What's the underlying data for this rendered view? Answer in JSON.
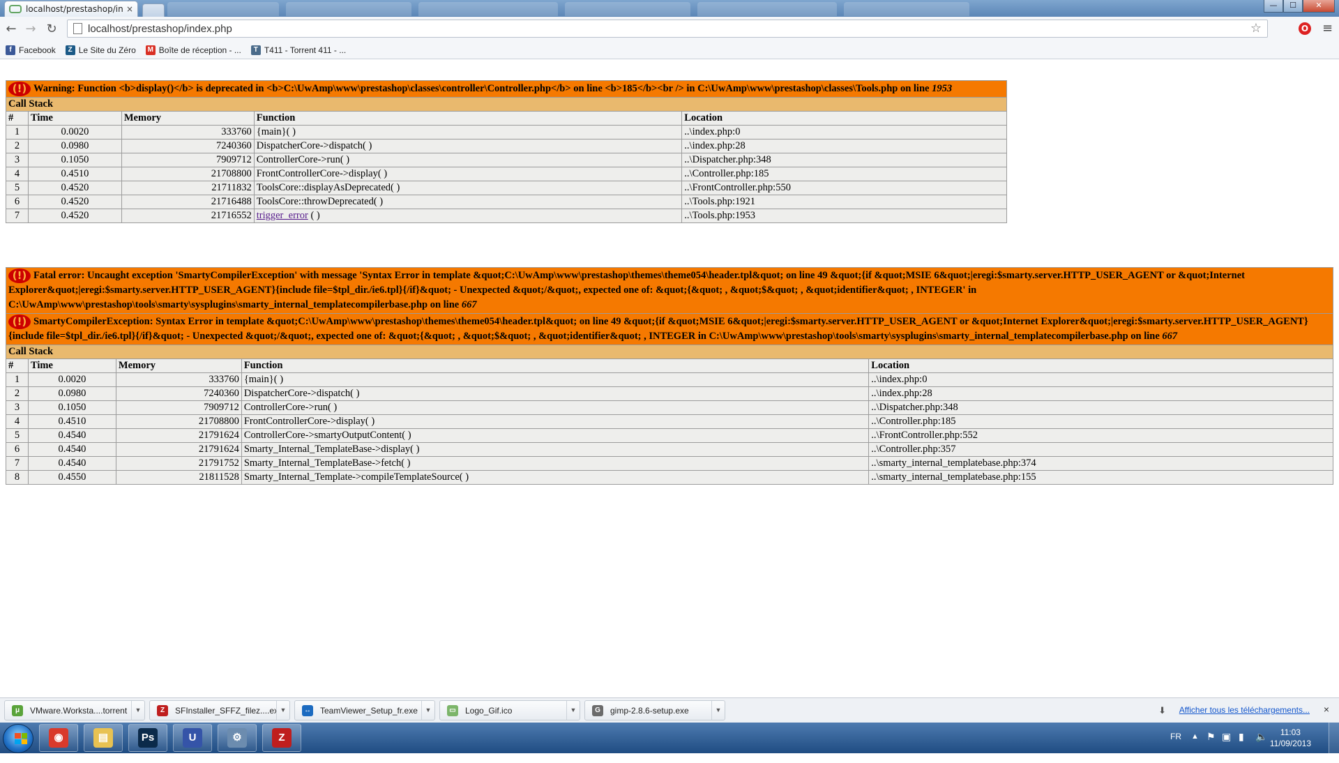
{
  "browser": {
    "tab_title": "localhost/prestashop/index.php",
    "tab_close": "×",
    "address": "localhost/prestashop/index.php",
    "window_controls": {
      "minimize": "—",
      "maximize": "☐",
      "close": "✕"
    },
    "bookmarks": [
      {
        "label": "Facebook",
        "icon": "facebook-icon",
        "color": "#3b5998",
        "glyph": "f"
      },
      {
        "label": "Le Site du Zéro",
        "icon": "siteduzero-icon",
        "color": "#1b5a87",
        "glyph": "Z"
      },
      {
        "label": "Boîte de réception - ...",
        "icon": "gmail-icon",
        "color": "#d93025",
        "glyph": "M"
      },
      {
        "label": "T411 - Torrent 411 - ...",
        "icon": "t411-icon",
        "color": "#4a6b8a",
        "glyph": "T"
      }
    ]
  },
  "warning": {
    "message_prefix": "Warning: Function <b>display()</b> is deprecated in <b>C:\\UwAmp\\www\\prestashop\\classes\\controller\\Controller.php</b> on line <b>185</b><br /> in C:\\UwAmp\\www\\prestashop\\classes\\Tools.php on line ",
    "line": "1953",
    "call_stack_label": "Call Stack",
    "columns": [
      "#",
      "Time",
      "Memory",
      "Function",
      "Location"
    ],
    "rows": [
      {
        "n": "1",
        "time": "0.0020",
        "memory": "333760",
        "func": "{main}( )",
        "loc": "..\\index.php:0"
      },
      {
        "n": "2",
        "time": "0.0980",
        "memory": "7240360",
        "func": "DispatcherCore->dispatch( )",
        "loc": "..\\index.php:28"
      },
      {
        "n": "3",
        "time": "0.1050",
        "memory": "7909712",
        "func": "ControllerCore->run( )",
        "loc": "..\\Dispatcher.php:348"
      },
      {
        "n": "4",
        "time": "0.4510",
        "memory": "21708800",
        "func": "FrontControllerCore->display( )",
        "loc": "..\\Controller.php:185"
      },
      {
        "n": "5",
        "time": "0.4520",
        "memory": "21711832",
        "func": "ToolsCore::displayAsDeprecated( )",
        "loc": "..\\FrontController.php:550"
      },
      {
        "n": "6",
        "time": "0.4520",
        "memory": "21716488",
        "func": "ToolsCore::throwDeprecated( )",
        "loc": "..\\Tools.php:1921"
      },
      {
        "n": "7",
        "time": "0.4520",
        "memory": "21716552",
        "func_link": "trigger_error",
        "func_suffix": " ( )",
        "loc": "..\\Tools.php:1953"
      }
    ]
  },
  "fatal": {
    "message1_prefix": "Fatal error: Uncaught exception 'SmartyCompilerException' with message 'Syntax Error in template &quot;C:\\UwAmp\\www\\prestashop\\themes\\theme054\\header.tpl&quot; on line 49 &quot;{if &quot;MSIE 6&quot;|eregi:$smarty.server.HTTP_USER_AGENT or &quot;Internet Explorer&quot;|eregi:$smarty.server.HTTP_USER_AGENT}{include file=$tpl_dir./ie6.tpl}{/if}&quot; - Unexpected &quot;/&quot;, expected one of: &quot;{&quot; , &quot;$&quot; , &quot;identifier&quot; , INTEGER' in C:\\UwAmp\\www\\prestashop\\tools\\smarty\\sysplugins\\smarty_internal_templatecompilerbase.php on line ",
    "line1": "667",
    "message2_prefix": "SmartyCompilerException: Syntax Error in template &quot;C:\\UwAmp\\www\\prestashop\\themes\\theme054\\header.tpl&quot; on line 49 &quot;{if &quot;MSIE 6&quot;|eregi:$smarty.server.HTTP_USER_AGENT or &quot;Internet Explorer&quot;|eregi:$smarty.server.HTTP_USER_AGENT}{include file=$tpl_dir./ie6.tpl}{/if}&quot; - Unexpected &quot;/&quot;, expected one of: &quot;{&quot; , &quot;$&quot; , &quot;identifier&quot; , INTEGER in C:\\UwAmp\\www\\prestashop\\tools\\smarty\\sysplugins\\smarty_internal_templatecompilerbase.php on line ",
    "line2": "667",
    "call_stack_label": "Call Stack",
    "columns": [
      "#",
      "Time",
      "Memory",
      "Function",
      "Location"
    ],
    "rows": [
      {
        "n": "1",
        "time": "0.0020",
        "memory": "333760",
        "func": "{main}( )",
        "loc": "..\\index.php:0"
      },
      {
        "n": "2",
        "time": "0.0980",
        "memory": "7240360",
        "func": "DispatcherCore->dispatch( )",
        "loc": "..\\index.php:28"
      },
      {
        "n": "3",
        "time": "0.1050",
        "memory": "7909712",
        "func": "ControllerCore->run( )",
        "loc": "..\\Dispatcher.php:348"
      },
      {
        "n": "4",
        "time": "0.4510",
        "memory": "21708800",
        "func": "FrontControllerCore->display( )",
        "loc": "..\\Controller.php:185"
      },
      {
        "n": "5",
        "time": "0.4540",
        "memory": "21791624",
        "func": "ControllerCore->smartyOutputContent( )",
        "loc": "..\\FrontController.php:552"
      },
      {
        "n": "6",
        "time": "0.4540",
        "memory": "21791624",
        "func": "Smarty_Internal_TemplateBase->display( )",
        "loc": "..\\Controller.php:357"
      },
      {
        "n": "7",
        "time": "0.4540",
        "memory": "21791752",
        "func": "Smarty_Internal_TemplateBase->fetch( )",
        "loc": "..\\smarty_internal_templatebase.php:374"
      },
      {
        "n": "8",
        "time": "0.4550",
        "memory": "21811528",
        "func": "Smarty_Internal_Template->compileTemplateSource( )",
        "loc": "..\\smarty_internal_templatebase.php:155"
      }
    ]
  },
  "error_icon_text": "(!)",
  "downloads": {
    "items": [
      {
        "name": "VMware.Worksta....torrent",
        "icon": "utorrent-icon",
        "color": "#5aa33a",
        "glyph": "μ"
      },
      {
        "name": "SFInstaller_SFFZ_filez....exe",
        "icon": "filezilla-icon",
        "color": "#bf1e1e",
        "glyph": "Z"
      },
      {
        "name": "TeamViewer_Setup_fr.exe",
        "icon": "teamviewer-icon",
        "color": "#1c6bc0",
        "glyph": "↔"
      },
      {
        "name": "Logo_Gif.ico",
        "icon": "ico-file-icon",
        "color": "#7cb56a",
        "glyph": "▭"
      },
      {
        "name": "gimp-2.8.6-setup.exe",
        "icon": "gimp-icon",
        "color": "#6b6b6b",
        "glyph": "G"
      }
    ],
    "show_all": "Afficher tous les téléchargements...",
    "close": "×"
  },
  "taskbar": {
    "apps": [
      {
        "name": "chrome",
        "icon": "chrome-icon",
        "color": "#d93a2b",
        "glyph": "◉"
      },
      {
        "name": "explorer",
        "icon": "folder-icon",
        "color": "#e8c252",
        "glyph": "▤"
      },
      {
        "name": "photoshop",
        "icon": "photoshop-icon",
        "color": "#0b2a4a",
        "glyph": "Ps"
      },
      {
        "name": "uwamp",
        "icon": "uwamp-icon",
        "color": "#3554a8",
        "glyph": "U"
      },
      {
        "name": "network",
        "icon": "network-tool-icon",
        "color": "#6c8caf",
        "glyph": "⚙"
      },
      {
        "name": "filezilla",
        "icon": "filezilla-icon",
        "color": "#bf1e1e",
        "glyph": "Z"
      }
    ],
    "language": "FR",
    "time": "11:03",
    "date": "11/09/2013"
  }
}
